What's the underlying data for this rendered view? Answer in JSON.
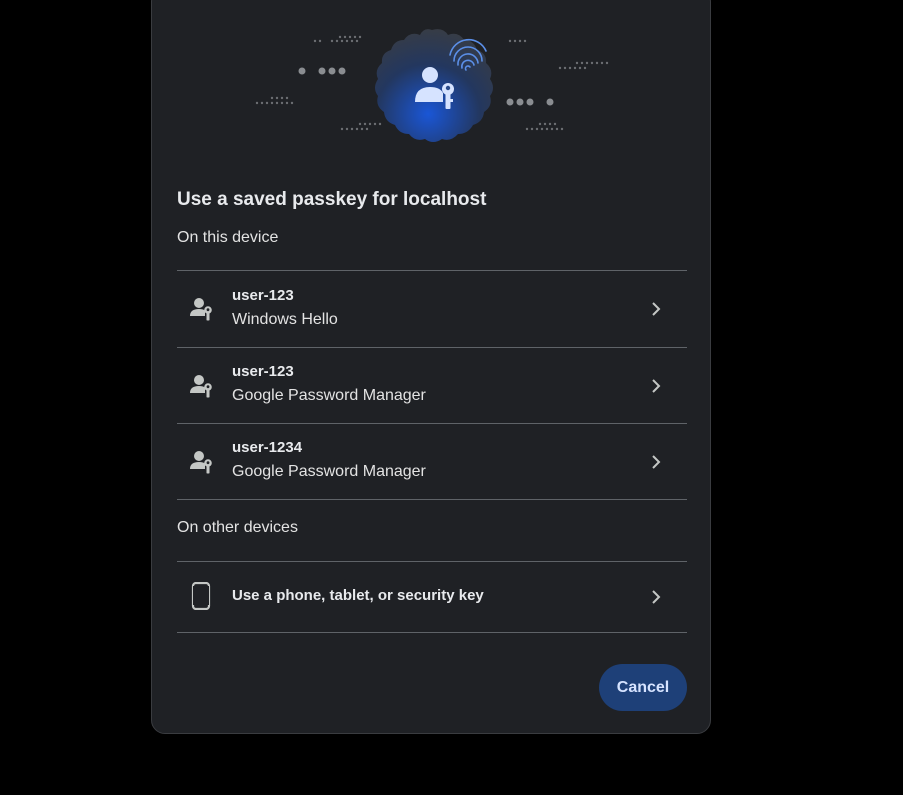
{
  "dialog": {
    "title": "Use a saved passkey for localhost",
    "section_this_device": "On this device",
    "section_other_devices": "On other devices",
    "passkeys": [
      {
        "username": "user-123",
        "provider": "Windows Hello",
        "icon": "passkey-user-icon"
      },
      {
        "username": "user-123",
        "provider": "Google Password Manager",
        "icon": "passkey-user-icon"
      },
      {
        "username": "user-1234",
        "provider": "Google Password Manager",
        "icon": "passkey-user-icon"
      }
    ],
    "other_device": {
      "label": "Use a phone, tablet, or security key",
      "icon": "phone-icon"
    },
    "cancel_label": "Cancel"
  },
  "colors": {
    "dialog_bg": "#1f2125",
    "accent": "#1e4078",
    "accent_text": "#d6e3ff",
    "hero_blue": "#1a56d6"
  }
}
